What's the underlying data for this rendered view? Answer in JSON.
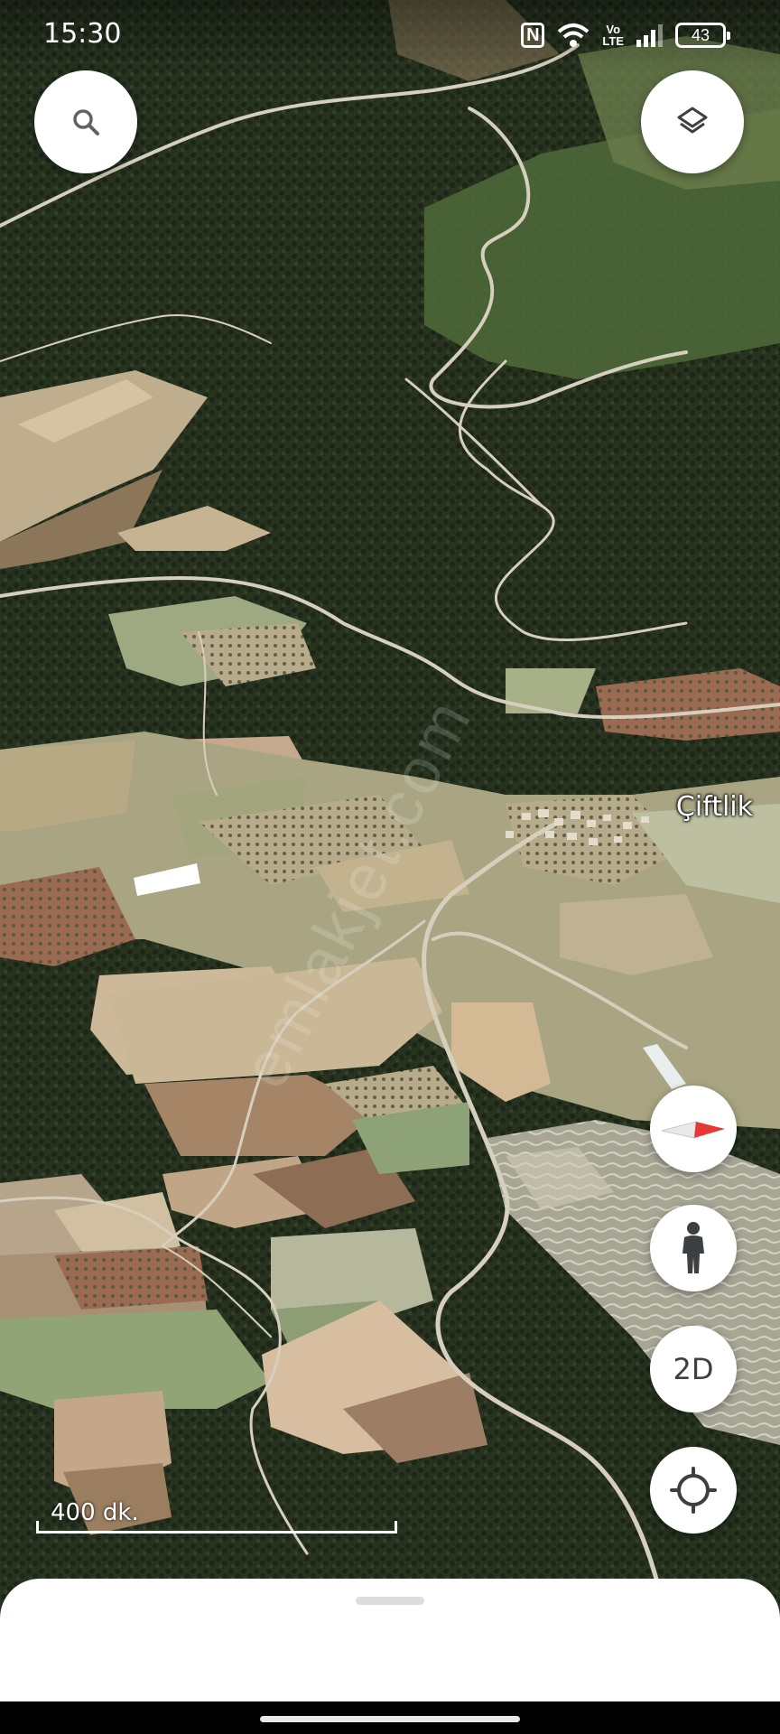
{
  "status_bar": {
    "time": "15:30",
    "nfc_label": "N",
    "volte_label_top": "Vo",
    "volte_label_bottom": "LTE",
    "battery_level": "43"
  },
  "map": {
    "place_label": "Çiftlik",
    "scale_label": "400 dk.",
    "watermark": "emlakjet.com"
  },
  "controls": {
    "search_icon": "search-icon",
    "layers_icon": "layers-icon",
    "compass_icon": "compass-icon",
    "pegman_icon": "pegman-icon",
    "view_mode_label": "2D",
    "location_icon": "my-location-icon"
  },
  "colors": {
    "forest": "#25301f",
    "field_light": "#c9b89a",
    "field_green": "#8f9e74",
    "road": "#d7d0bf",
    "compass_red": "#e53935"
  }
}
